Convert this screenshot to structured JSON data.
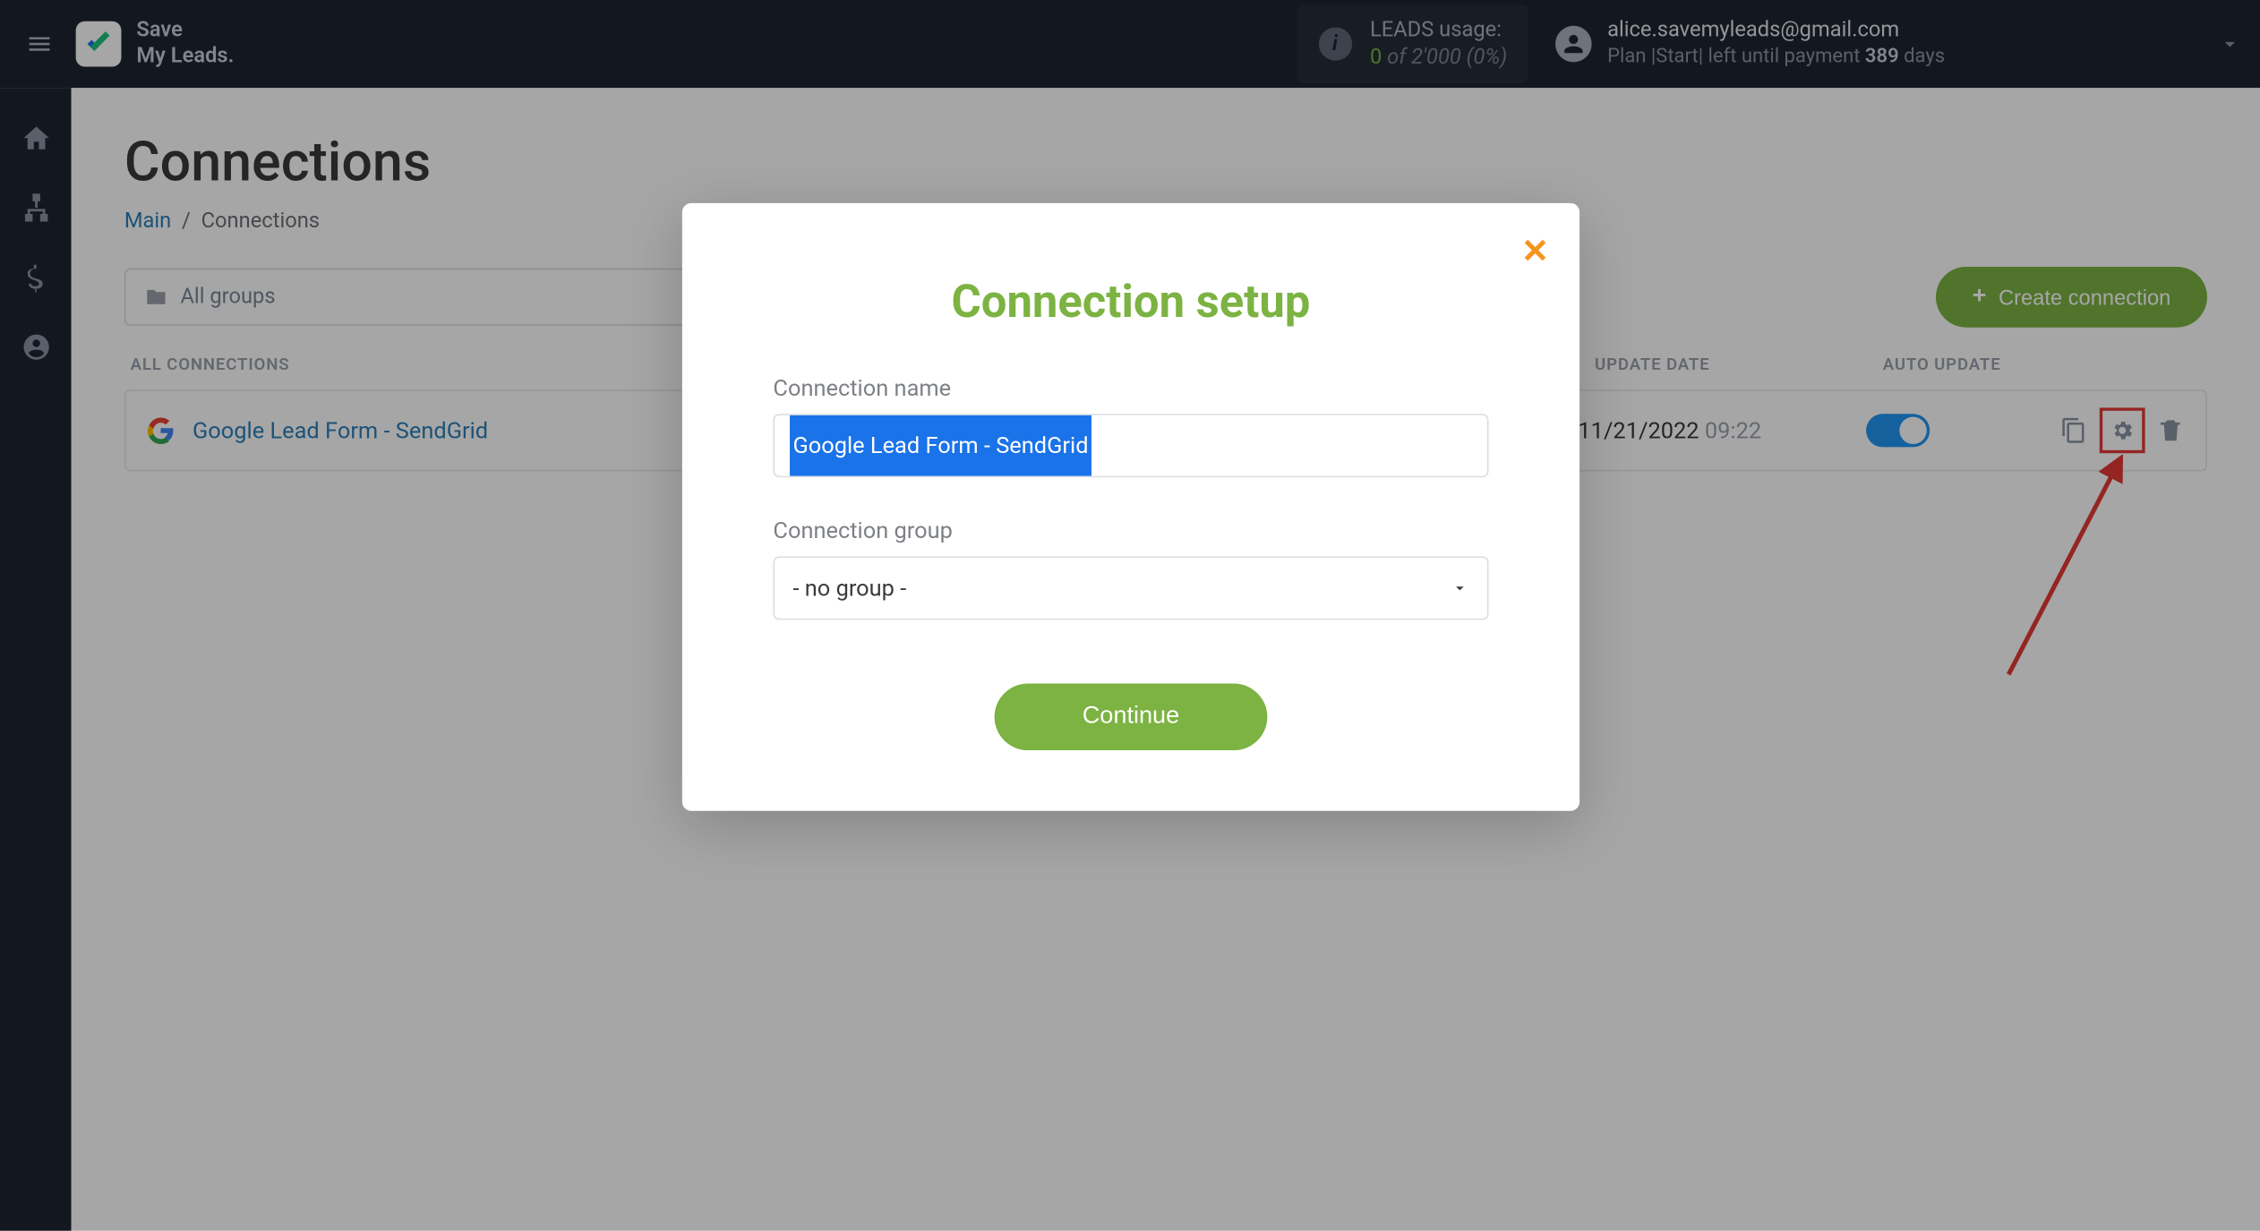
{
  "brand": {
    "line1": "Save",
    "line2": "My Leads."
  },
  "header": {
    "leads_label": "LEADS usage:",
    "leads_count": "0",
    "leads_of": "of 2'000",
    "leads_pct": "(0%)",
    "user_email": "alice.savemyleads@gmail.com",
    "plan_prefix": "Plan |Start| left until payment ",
    "plan_days": "389",
    "plan_suffix": " days"
  },
  "page": {
    "title": "Connections",
    "breadcrumb_main": "Main",
    "breadcrumb_current": "Connections"
  },
  "toolbar": {
    "group_select": "All groups",
    "create_btn": "Create connection"
  },
  "table": {
    "col_name": "ALL CONNECTIONS",
    "col_date": "UPDATE DATE",
    "col_auto": "AUTO UPDATE",
    "rows": [
      {
        "name": "Google Lead Form - SendGrid",
        "date": "11/21/2022",
        "time": "09:22",
        "auto_update": true
      }
    ]
  },
  "modal": {
    "title": "Connection setup",
    "name_label": "Connection name",
    "name_value": "Google Lead Form - SendGrid",
    "group_label": "Connection group",
    "group_value": "- no group -",
    "continue": "Continue"
  }
}
